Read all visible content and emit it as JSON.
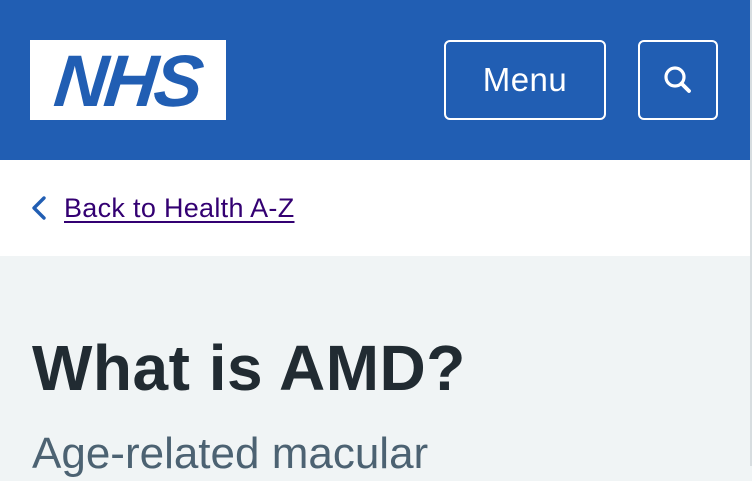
{
  "header": {
    "logo_text": "NHS",
    "menu_label": "Menu",
    "search_icon": "search-icon",
    "colors": {
      "brand_blue": "#215eb3",
      "white": "#ffffff"
    }
  },
  "breadcrumb": {
    "back_label": "Back to Health A-Z",
    "chevron_icon": "chevron-left-icon",
    "colors": {
      "link": "#330072",
      "chevron": "#215eb3"
    }
  },
  "main": {
    "title": "What is AMD?",
    "subtitle": "Age-related macular",
    "colors": {
      "title": "#212b32",
      "subtitle": "#4c6272",
      "background": "#f0f4f5"
    }
  }
}
